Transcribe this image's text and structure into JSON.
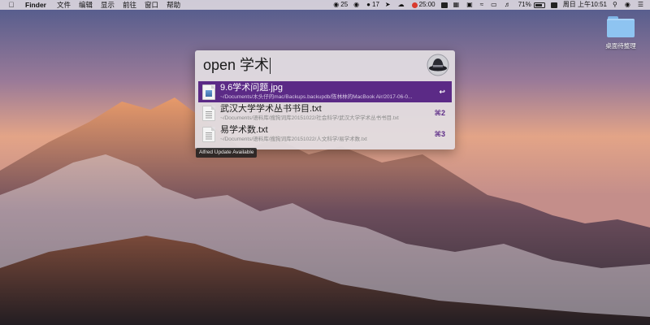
{
  "menubar": {
    "apple_icon": "apple-icon",
    "app_name": "Finder",
    "items": [
      "文件",
      "编辑",
      "显示",
      "前往",
      "窗口",
      "帮助"
    ],
    "status": {
      "notifications_count": "25",
      "messages_count": "17",
      "timer": "25:00",
      "battery_percent": "71%",
      "datetime": "周日 上午10:51"
    }
  },
  "desktop": {
    "folder_label": "桌面待整理"
  },
  "alfred": {
    "query": "open 学术",
    "results": [
      {
        "title": "9.6学术问题.jpg",
        "subtitle": "~/Documents/木头仔的mac/Backups.backupdb/陈林林的MacBook Air/2017-06-0...",
        "shortcut": "↩",
        "icon": "image-file-icon"
      },
      {
        "title": "武汉大学学术丛书书目.txt",
        "subtitle": "~/Documents/语料库/搜狗词库20151022/社会科学/武汉大学学术丛书书目.txt",
        "shortcut": "⌘2",
        "icon": "text-file-icon"
      },
      {
        "title": "易学术数.txt",
        "subtitle": "~/Documents/语料库/搜狗词库20151022/人文科学/易学术数.txt",
        "shortcut": "⌘3",
        "icon": "text-file-icon"
      }
    ],
    "update_notice": "Alfred Update Available"
  }
}
